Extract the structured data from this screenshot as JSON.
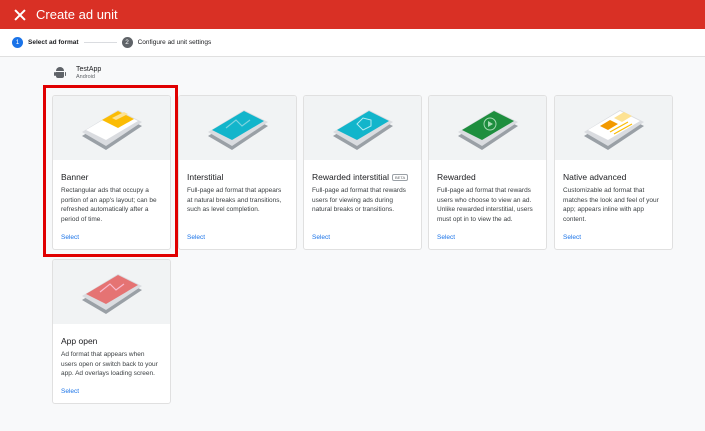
{
  "header": {
    "title": "Create ad unit",
    "close_icon": "close-icon"
  },
  "stepper": {
    "steps": [
      {
        "number": "1",
        "label": "Select ad format",
        "active": true
      },
      {
        "number": "2",
        "label": "Configure ad unit settings",
        "active": false
      }
    ]
  },
  "app": {
    "name": "TestApp",
    "platform": "Android",
    "icon": "android-icon"
  },
  "cards": [
    {
      "title": "Banner",
      "badge": "",
      "description": "Rectangular ads that occupy a portion of an app's layout; can be refreshed automatically after a period of time.",
      "select": "Select",
      "accent": "#fbbc04"
    },
    {
      "title": "Interstitial",
      "badge": "",
      "description": "Full-page ad format that appears at natural breaks and transitions, such as level completion.",
      "select": "Select",
      "accent": "#12b5cb"
    },
    {
      "title": "Rewarded interstitial",
      "badge": "BETA",
      "description": "Full-page ad format that rewards users for viewing ads during natural breaks or transitions.",
      "select": "Select",
      "accent": "#12b5cb"
    },
    {
      "title": "Rewarded",
      "badge": "",
      "description": "Full-page ad format that rewards users who choose to view an ad. Unlike rewarded interstitial, users must opt in to view the ad.",
      "select": "Select",
      "accent": "#1e8e3e"
    },
    {
      "title": "Native advanced",
      "badge": "",
      "description": "Customizable ad format that matches the look and feel of your app; appears inline with app content.",
      "select": "Select",
      "accent": "#f29900"
    },
    {
      "title": "App open",
      "badge": "",
      "description": "Ad format that appears when users open or switch back to your app. Ad overlays loading screen.",
      "select": "Select",
      "accent": "#e57373"
    }
  ],
  "colors": {
    "header_bg": "#d93025",
    "link": "#1a73e8",
    "highlight": "#e00000"
  }
}
